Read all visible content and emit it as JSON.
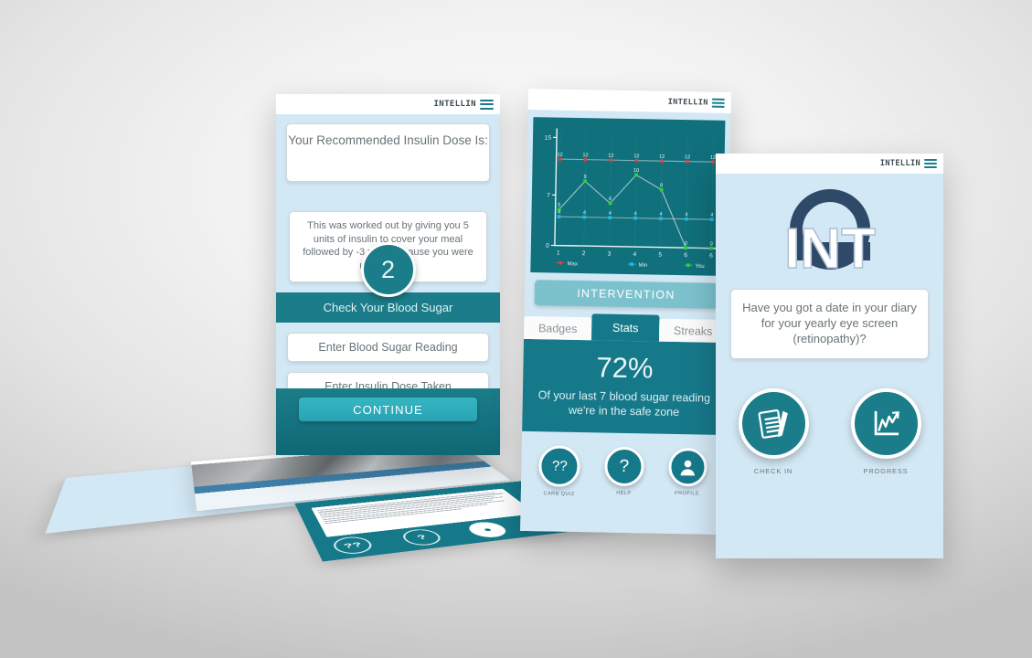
{
  "brand": {
    "name": "INTELLIN",
    "menu_icon": "hamburger-menu-icon",
    "accent": "#1b7d89",
    "screen_bg": "#d3e8f5",
    "dark_teal": "#10707c"
  },
  "phone1": {
    "dose_title": "Your Recommended Insulin Dose Is:",
    "dose_value": "2",
    "explanation": "This was worked out by giving you 5 units of insulin to cover your meal followed by -3 units because you were under target.",
    "section_title": "Check Your Blood Sugar",
    "inputs": [
      {
        "placeholder": "Enter Blood Sugar Reading",
        "value": "",
        "name": "blood-sugar-input"
      },
      {
        "placeholder": "Enter Insulin Dose Taken",
        "value": "",
        "name": "insulin-dose-input"
      }
    ],
    "continue_label": "CONTINUE"
  },
  "phone2": {
    "intervention_label": "INTERVENTION",
    "tabs": [
      {
        "label": "Badges",
        "active": false
      },
      {
        "label": "Stats",
        "active": true
      },
      {
        "label": "Streaks",
        "active": false
      }
    ],
    "stat_percent": "72%",
    "stat_subtitle": "Of your last 7 blood sugar reading we're in the safe zone",
    "nav": [
      {
        "label": "CARB QUIZ",
        "icon": "question-marks-icon"
      },
      {
        "label": "HELP",
        "icon": "question-mark-icon"
      },
      {
        "label": "PROFILE",
        "icon": "person-icon"
      }
    ]
  },
  "phone3": {
    "logo_text": "INT",
    "logo_icon": "intellin-ring-logo",
    "question": "Have you got a date in your diary for your yearly eye screen (retinopathy)?",
    "actions": [
      {
        "label": "CHECK IN",
        "icon": "clipboard-pen-icon"
      },
      {
        "label": "PROGRESS",
        "icon": "growth-chart-icon"
      }
    ]
  },
  "chart_data": {
    "type": "line",
    "title": "",
    "xlabel": "",
    "ylabel": "",
    "x": [
      1,
      2,
      3,
      4,
      5,
      6,
      7
    ],
    "xtick_labels": [
      "1",
      "2",
      "3",
      "4",
      "5",
      "6",
      "6"
    ],
    "ytick_labels": [
      "0",
      "7",
      "15"
    ],
    "yticks": [
      0,
      7,
      15
    ],
    "ylim": [
      0,
      16
    ],
    "grid": true,
    "legend_position": "bottom",
    "series": [
      {
        "name": "Max",
        "color": "#e8413a",
        "line_color": "#9bbfc4",
        "values": [
          12,
          12,
          12,
          12,
          12,
          12,
          12
        ]
      },
      {
        "name": "Min",
        "color": "#1fb6e8",
        "line_color": "#9bbfc4",
        "values": [
          4,
          4,
          4,
          4,
          4,
          4,
          4
        ]
      },
      {
        "name": "You",
        "color": "#2fcf3d",
        "line_color": "#b9d7da",
        "values": [
          5,
          9,
          6,
          10,
          8,
          0,
          0
        ]
      }
    ]
  }
}
